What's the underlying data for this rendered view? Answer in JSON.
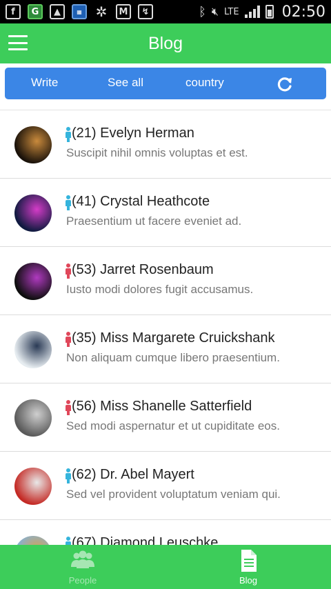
{
  "status_bar": {
    "time": "02:50",
    "network": "LTE",
    "icons": [
      "facebook-icon",
      "g-app-icon",
      "gallery-icon",
      "calendar-icon",
      "network-icon",
      "gmail-icon",
      "vpn-icon",
      "bluetooth-icon",
      "mute-icon",
      "signal-icon",
      "battery-icon"
    ]
  },
  "app_bar": {
    "title": "Blog",
    "menu_icon": "hamburger-menu-icon"
  },
  "tabs": {
    "write": "Write",
    "see_all": "See all",
    "country": "country",
    "refresh_icon": "refresh-icon"
  },
  "entries": [
    {
      "name": "(21) Evelyn Herman",
      "snippet": "Suscipit nihil omnis voluptas et est.",
      "gender": "male",
      "gender_color": "#35b4dc",
      "avatar_colors": [
        "#1a120a",
        "#c98a3c"
      ]
    },
    {
      "name": "(41) Crystal Heathcote",
      "snippet": "Praesentium ut facere eveniet ad.",
      "gender": "male",
      "gender_color": "#35b4dc",
      "avatar_colors": [
        "#101a40",
        "#d43cc8"
      ]
    },
    {
      "name": "(53) Jarret Rosenbaum",
      "snippet": "Iusto modi dolores fugit accusamus.",
      "gender": "female",
      "gender_color": "#e0475a",
      "avatar_colors": [
        "#0e0e0e",
        "#b03ac0"
      ]
    },
    {
      "name": "(35) Miss Margarete Cruickshank",
      "snippet": "Non aliquam cumque libero praesentium.",
      "gender": "female",
      "gender_color": "#e0475a",
      "avatar_colors": [
        "#e6ecf0",
        "#2a3a55"
      ]
    },
    {
      "name": "(56) Miss Shanelle Satterfield",
      "snippet": "Sed modi aspernatur et ut cupiditate eos.",
      "gender": "female",
      "gender_color": "#e0475a",
      "avatar_colors": [
        "#5a5a5a",
        "#cfcfcf"
      ]
    },
    {
      "name": "(62) Dr. Abel Mayert",
      "snippet": "Sed vel provident voluptatum veniam qui.",
      "gender": "male",
      "gender_color": "#35b4dc",
      "avatar_colors": [
        "#c42a25",
        "#e8e8e8"
      ]
    },
    {
      "name": "(67) Diamond Leuschke",
      "snippet": "",
      "gender": "male",
      "gender_color": "#35b4dc",
      "avatar_colors": [
        "#7fb2e0",
        "#d9a24a"
      ]
    }
  ],
  "bottom_nav": [
    {
      "label": "People",
      "icon": "people-icon",
      "active": false
    },
    {
      "label": "Blog",
      "icon": "document-icon",
      "active": true
    }
  ],
  "colors": {
    "primary_green": "#3dcd5a",
    "tab_blue": "#3b86e6",
    "male": "#35b4dc",
    "female": "#e0475a"
  }
}
